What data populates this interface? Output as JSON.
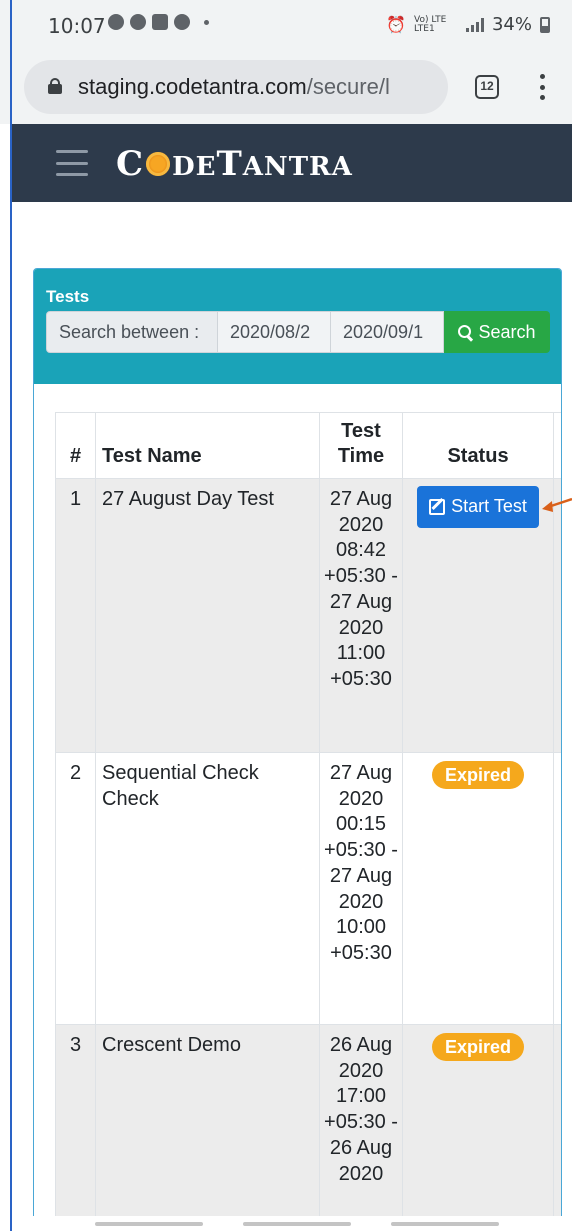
{
  "status_bar": {
    "time": "10:07",
    "network": "Vo) LTE LTE1",
    "battery": "34%"
  },
  "browser": {
    "url_host": "staging.codetantra.com",
    "url_path": "/secure/l",
    "tab_count": "12"
  },
  "app": {
    "logo_c": "C",
    "logo_de": "DE",
    "logo_t": "T",
    "logo_antra": "ANTRA"
  },
  "panel": {
    "title": "Tests",
    "search_label": "Search between :",
    "date_from": "2020/08/2",
    "date_to": "2020/09/1",
    "search_button": "Search"
  },
  "table": {
    "headers": {
      "num": "#",
      "name": "Test Name",
      "time": "Test Time",
      "status": "Status"
    },
    "rows": [
      {
        "num": "1",
        "name": "27 August Day Test",
        "time": "27 Aug 2020 08:42 +05:30 - 27 Aug 2020 11:00 +05:30",
        "status": "Start Test"
      },
      {
        "num": "2",
        "name": "Sequential Check Check",
        "time": "27 Aug 2020 00:15 +05:30 - 27 Aug 2020 10:00 +05:30",
        "status": "Expired"
      },
      {
        "num": "3",
        "name": "Crescent Demo",
        "time": "26 Aug 2020 17:00 +05:30 - 26 Aug 2020",
        "status": "Expired"
      }
    ]
  },
  "colors": {
    "header_bg": "#2d3a4b",
    "panel_head": "#1aa3b8",
    "search_green": "#28a745",
    "start_blue": "#1a73d9",
    "expired_orange": "#f5a81c",
    "arrow": "#d9601a"
  }
}
